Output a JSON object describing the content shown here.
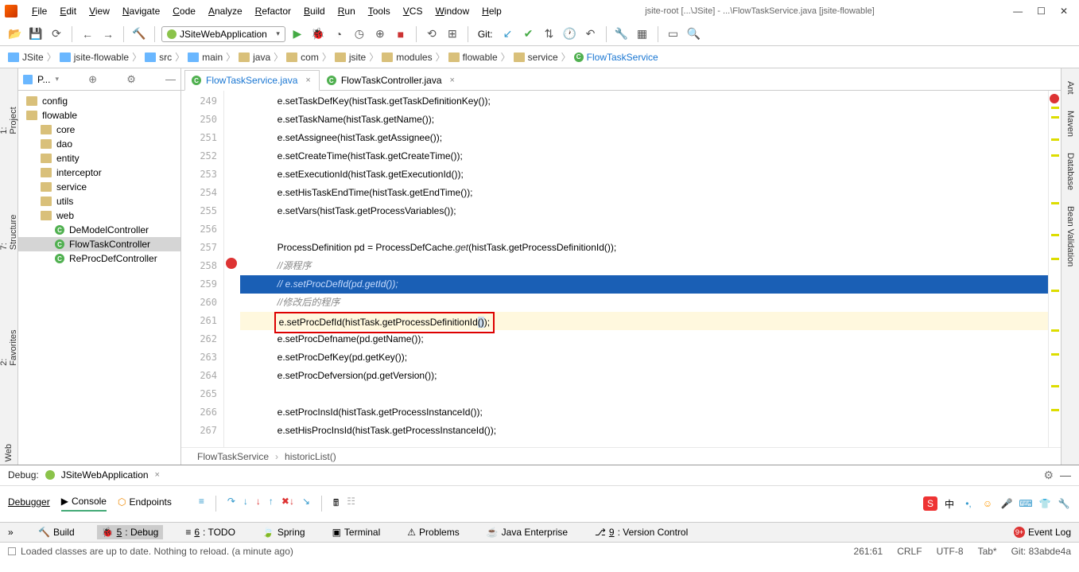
{
  "title": "jsite-root [...\\JSite] - ...\\FlowTaskService.java [jsite-flowable]",
  "menus": [
    "File",
    "Edit",
    "View",
    "Navigate",
    "Code",
    "Analyze",
    "Refactor",
    "Build",
    "Run",
    "Tools",
    "VCS",
    "Window",
    "Help"
  ],
  "run_config": "JSiteWebApplication",
  "git_label": "Git:",
  "breadcrumbs": [
    "JSite",
    "jsite-flowable",
    "src",
    "main",
    "java",
    "com",
    "jsite",
    "modules",
    "flowable",
    "service",
    "FlowTaskService"
  ],
  "left_tabs": [
    "1: Project",
    "7: Structure",
    "2: Favorites",
    "Web"
  ],
  "right_tabs": [
    "Ant",
    "Maven",
    "Database",
    "Bean Validation"
  ],
  "project_header": "P...",
  "tree": [
    {
      "t": "config",
      "d": 0,
      "ico": "f"
    },
    {
      "t": "flowable",
      "d": 0,
      "ico": "f"
    },
    {
      "t": "core",
      "d": 1,
      "ico": "f"
    },
    {
      "t": "dao",
      "d": 1,
      "ico": "f"
    },
    {
      "t": "entity",
      "d": 1,
      "ico": "f"
    },
    {
      "t": "interceptor",
      "d": 1,
      "ico": "f"
    },
    {
      "t": "service",
      "d": 1,
      "ico": "f"
    },
    {
      "t": "utils",
      "d": 1,
      "ico": "f"
    },
    {
      "t": "web",
      "d": 1,
      "ico": "f"
    },
    {
      "t": "DeModelController",
      "d": 2,
      "ico": "c"
    },
    {
      "t": "FlowTaskController",
      "d": 2,
      "ico": "c",
      "sel": true
    },
    {
      "t": "ReProcDefController",
      "d": 2,
      "ico": "c"
    }
  ],
  "editor_tabs": [
    {
      "label": "FlowTaskService.java",
      "active": true
    },
    {
      "label": "FlowTaskController.java",
      "active": false
    }
  ],
  "line_start": 249,
  "code_lines": [
    {
      "n": 249,
      "txt": "e.setTaskDefKey(histTask.getTaskDefinitionKey());"
    },
    {
      "n": 250,
      "txt": "e.setTaskName(histTask.getName());"
    },
    {
      "n": 251,
      "txt": "e.setAssignee(histTask.getAssignee());"
    },
    {
      "n": 252,
      "txt": "e.setCreateTime(histTask.getCreateTime());"
    },
    {
      "n": 253,
      "txt": "e.setExecutionId(histTask.getExecutionId());"
    },
    {
      "n": 254,
      "txt": "e.setHisTaskEndTime(histTask.getEndTime());"
    },
    {
      "n": 255,
      "txt": "e.setVars(histTask.getProcessVariables());"
    },
    {
      "n": 256,
      "txt": ""
    },
    {
      "n": 257,
      "txt": "ProcessDefinition pd = ProcessDefCache.get(histTask.getProcessDefinitionId());",
      "kw": "get"
    },
    {
      "n": 258,
      "txt": "//源程序",
      "cmt": true
    },
    {
      "n": 259,
      "txt": "// e.setProcDefId(pd.getId());",
      "cmt": true,
      "hl": "blue"
    },
    {
      "n": 260,
      "txt": "//修改后的程序",
      "cmt": true
    },
    {
      "n": 261,
      "txt": "e.setProcDefId(histTask.getProcessDefinitionId());",
      "hl": "yellow",
      "box": true
    },
    {
      "n": 262,
      "txt": "e.setProcDefname(pd.getName());"
    },
    {
      "n": 263,
      "txt": "e.setProcDefKey(pd.getKey());"
    },
    {
      "n": 264,
      "txt": "e.setProcDefversion(pd.getVersion());"
    },
    {
      "n": 265,
      "txt": ""
    },
    {
      "n": 266,
      "txt": "e.setProcInsId(histTask.getProcessInstanceId());"
    },
    {
      "n": 267,
      "txt": "e.setHisProcInsId(histTask.getProcessInstanceId());"
    }
  ],
  "editor_breadcrumb": [
    "FlowTaskService",
    "historicList()"
  ],
  "debug": {
    "label": "Debug:",
    "config": "JSiteWebApplication",
    "tabs": [
      "Debugger",
      "Console",
      "Endpoints"
    ]
  },
  "bottom_tabs": [
    {
      "ico": "🔨",
      "label": "Build",
      "u": ""
    },
    {
      "ico": "🐞",
      "label": "Debug",
      "u": "5",
      "active": true
    },
    {
      "ico": "≡",
      "label": "TODO",
      "u": "6"
    },
    {
      "ico": "🍃",
      "label": "Spring",
      "u": ""
    },
    {
      "ico": "▣",
      "label": "Terminal",
      "u": ""
    },
    {
      "ico": "⚠",
      "label": "Problems",
      "u": ""
    },
    {
      "ico": "☕",
      "label": "Java Enterprise",
      "u": ""
    },
    {
      "ico": "⎇",
      "label": "Version Control",
      "u": "9"
    }
  ],
  "event_log": {
    "badge": "9+",
    "label": "Event Log"
  },
  "status": {
    "msg": "Loaded classes are up to date. Nothing to reload. (a minute ago)",
    "pos": "261:61",
    "eol": "CRLF",
    "enc": "UTF-8",
    "indent": "Tab*",
    "git": "Git: 83abde4a"
  }
}
